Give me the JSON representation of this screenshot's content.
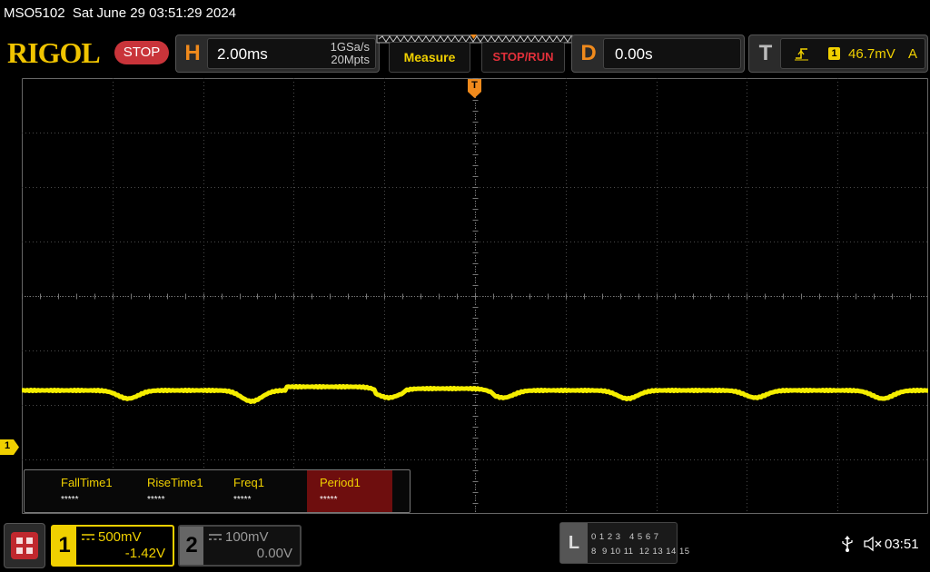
{
  "status_bar": {
    "title": "MSO5102  Sat June 29 03:51:29 2024"
  },
  "header": {
    "logo": "RIGOL",
    "run_state": "STOP",
    "horizontal": {
      "letter": "H",
      "timebase": "2.00ms",
      "sample_rate": "1GSa/s",
      "memory_depth": "20Mpts"
    },
    "measure_label": "Measure",
    "stop_run_label": "STOP/RUN",
    "delay": {
      "letter": "D",
      "value": "0.00s"
    },
    "trigger": {
      "letter": "T",
      "source": "1",
      "level": "46.7mV",
      "mode": "A"
    }
  },
  "waveform": {
    "channel_marker": "1",
    "trigger_marker": "T",
    "trace_color": "#f5ee00"
  },
  "measurements": [
    {
      "name": "FallTime1",
      "value": "*****",
      "selected": false
    },
    {
      "name": "RiseTime1",
      "value": "*****",
      "selected": false
    },
    {
      "name": "Freq1",
      "value": "*****",
      "selected": false
    },
    {
      "name": "Period1",
      "value": "*****",
      "selected": true
    }
  ],
  "channels": [
    {
      "number": "1",
      "scale": "500mV",
      "offset": "-1.42V",
      "active": true,
      "color": "#f0d000"
    },
    {
      "number": "2",
      "scale": "100mV",
      "offset": "0.00V",
      "active": false,
      "color": "#888888"
    }
  ],
  "logic": {
    "letter": "L",
    "row1": "0 1 2 3   4 5 6 7",
    "row2": "8  9 10 11  12 13 14 15"
  },
  "footer": {
    "time": "03:51"
  },
  "colors": {
    "accent_orange": "#f08a1c",
    "stop_red": "#c9343a",
    "ch1_yellow": "#f0d000"
  }
}
